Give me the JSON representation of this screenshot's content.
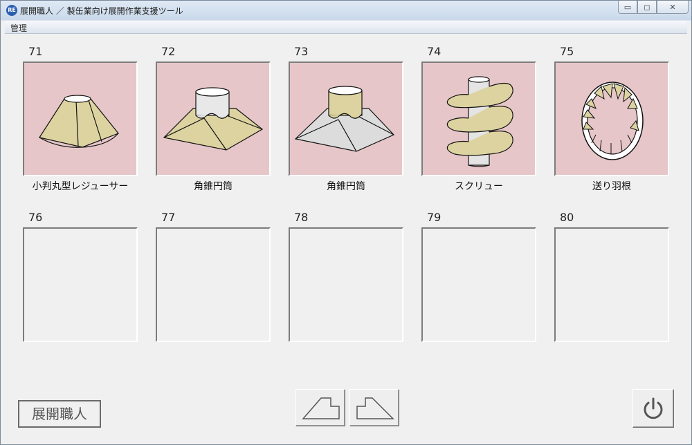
{
  "window": {
    "app_icon_text": "RE",
    "title": "展開職人 ／ 製缶業向け展開作業支援ツール",
    "minimize_symbol": "▭",
    "maximize_symbol": "◻",
    "close_symbol": "✕"
  },
  "menu": {
    "items": [
      {
        "label": "管理"
      }
    ]
  },
  "tiles": [
    {
      "number": "71",
      "label": "小判丸型レジューサー",
      "icon": "oval-reducer-icon"
    },
    {
      "number": "72",
      "label": "角錐円筒",
      "icon": "pyramid-cylinder-icon"
    },
    {
      "number": "73",
      "label": "角錐円筒",
      "icon": "pyramid-cylinder-alt-icon"
    },
    {
      "number": "74",
      "label": "スクリュー",
      "icon": "screw-icon"
    },
    {
      "number": "75",
      "label": "送り羽根",
      "icon": "feed-blade-icon"
    },
    {
      "number": "76",
      "label": ""
    },
    {
      "number": "77",
      "label": ""
    },
    {
      "number": "78",
      "label": ""
    },
    {
      "number": "79",
      "label": ""
    },
    {
      "number": "80",
      "label": ""
    }
  ],
  "footer": {
    "brand_label": "展開職人",
    "prev_icon": "previous-page-icon",
    "next_icon": "next-page-icon",
    "power_icon": "power-icon"
  },
  "colors": {
    "tile_fill": "#e6c6c8",
    "shape_tan": "#dcd3a0",
    "shape_grey": "#dcdcdc"
  }
}
